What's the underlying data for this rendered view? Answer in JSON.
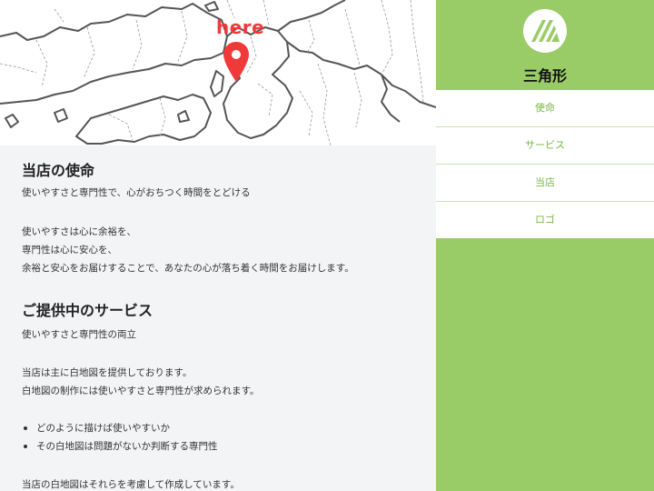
{
  "map": {
    "marker_label": "here",
    "marker_color": "#f03a3a",
    "icon": "map-pin-icon"
  },
  "mission": {
    "title": "当店の使命",
    "lead": "使いやすさと専門性で、心がおちつく時間をとどける",
    "lines": [
      "使いやすさは心に余裕を、",
      "専門性は心に安心を、",
      "余裕と安心をお届けすることで、あなたの心が落ち着く時間をお届けします。"
    ]
  },
  "services": {
    "title": "ご提供中のサービス",
    "lead": "使いやすさと専門性の両立",
    "lines": [
      "当店は主に白地図を提供しております。",
      "白地図の制作には使いやすさと専門性が求められます。"
    ],
    "bullets": [
      "どのように描けば使いやすいか",
      "その白地図は問題がないか判断する専門性"
    ],
    "closing": "当店の白地図はそれらを考慮して作成しています。"
  },
  "sidebar": {
    "site_title": "三角形",
    "logo_icon": "triangle-stripes-logo-icon",
    "nav": [
      "使命",
      "サービス",
      "当店",
      "ロゴ"
    ]
  },
  "colors": {
    "accent": "#99cc66",
    "nav_text": "#77b844",
    "content_bg": "#f3f4f6"
  }
}
